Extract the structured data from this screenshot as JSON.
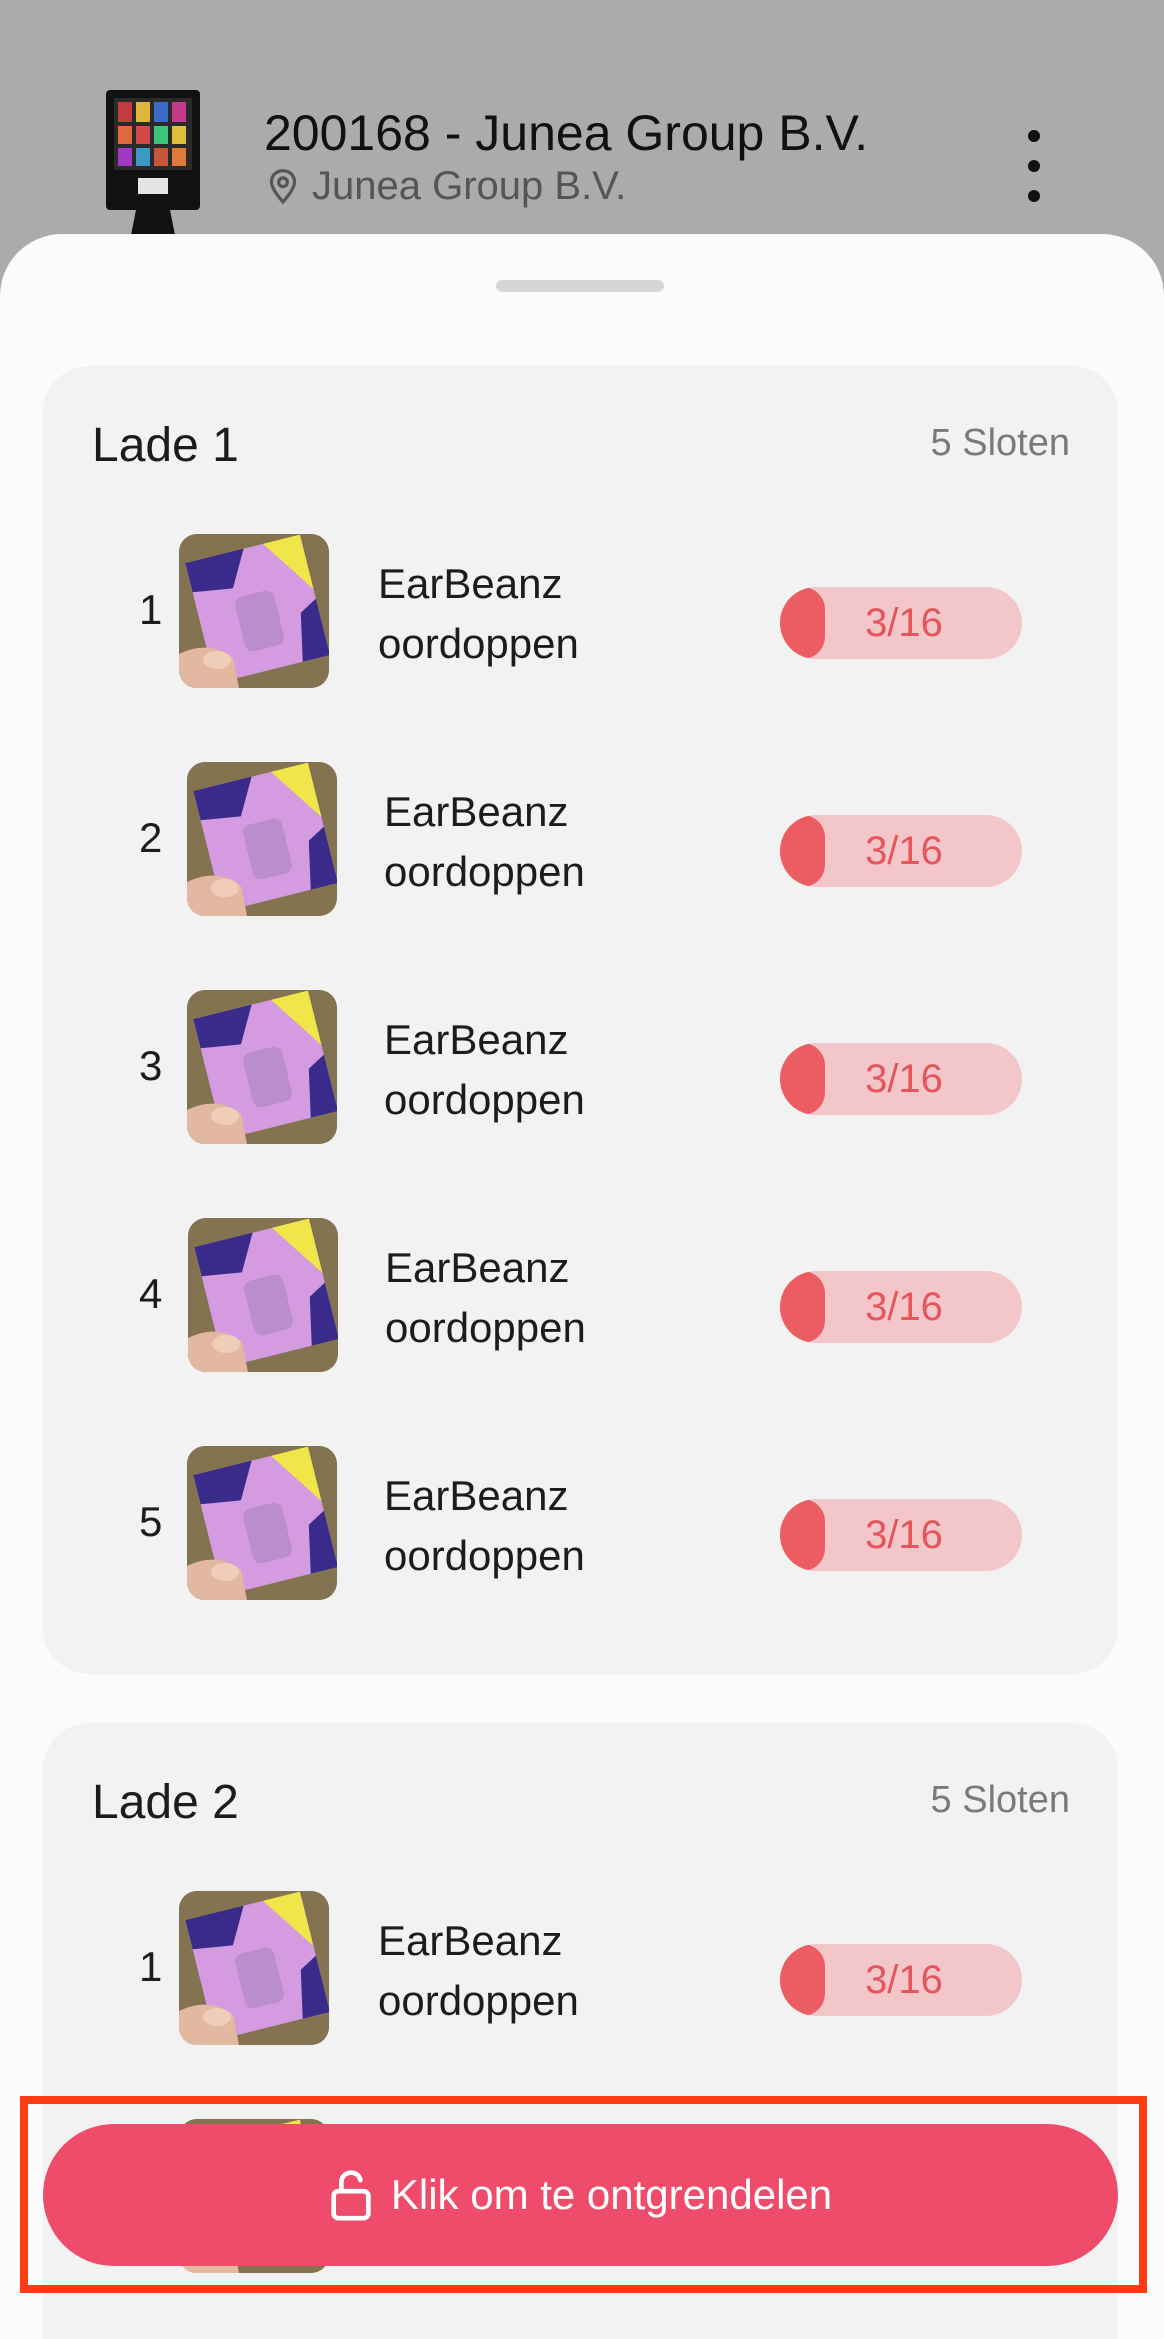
{
  "header": {
    "title": "200168 - Junea Group B.V.",
    "location": "Junea Group B.V.",
    "location_icon": "location-pin-icon",
    "menu_icon": "more-vertical-icon"
  },
  "drawers": [
    {
      "title": "Lade 1",
      "slot_count": "5 Sloten",
      "slots": [
        {
          "number": "1",
          "name_line1": "EarBeanz",
          "name_line2": "oordoppen",
          "stock": "3/16",
          "stock_fraction": 0.1875
        },
        {
          "number": "2",
          "name_line1": "EarBeanz",
          "name_line2": "oordoppen",
          "stock": "3/16",
          "stock_fraction": 0.1875
        },
        {
          "number": "3",
          "name_line1": "EarBeanz",
          "name_line2": "oordoppen",
          "stock": "3/16",
          "stock_fraction": 0.1875
        },
        {
          "number": "4",
          "name_line1": "EarBeanz",
          "name_line2": "oordoppen",
          "stock": "3/16",
          "stock_fraction": 0.1875
        },
        {
          "number": "5",
          "name_line1": "EarBeanz",
          "name_line2": "oordoppen",
          "stock": "3/16",
          "stock_fraction": 0.1875
        }
      ]
    },
    {
      "title": "Lade 2",
      "slot_count": "5 Sloten",
      "slots": [
        {
          "number": "1",
          "name_line1": "EarBeanz",
          "name_line2": "oordoppen",
          "stock": "3/16",
          "stock_fraction": 0.1875
        }
      ]
    }
  ],
  "unlock": {
    "label": "Klik om te ontgrendelen",
    "icon": "unlock-icon"
  },
  "colors": {
    "accent": "#ef4c6b",
    "stock_low_fill": "#ec5d63",
    "stock_low_bg": "#f3c6c9",
    "highlight": "#ff3b14"
  }
}
